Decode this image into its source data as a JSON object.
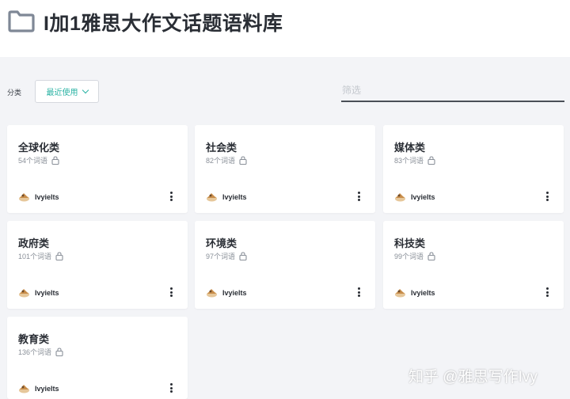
{
  "header": {
    "title": "I加1雅思大作文话题语料库"
  },
  "filter": {
    "category_label": "分类",
    "sort_value": "最近使用",
    "search_placeholder": "筛选"
  },
  "cards": [
    {
      "title": "全球化类",
      "count": "54个词语",
      "author": "Ivyielts"
    },
    {
      "title": "社会类",
      "count": "82个词语",
      "author": "Ivyielts"
    },
    {
      "title": "媒体类",
      "count": "83个词语",
      "author": "Ivyielts"
    },
    {
      "title": "政府类",
      "count": "101个词语",
      "author": "Ivyielts"
    },
    {
      "title": "环境类",
      "count": "97个词语",
      "author": "Ivyielts"
    },
    {
      "title": "科技类",
      "count": "99个词语",
      "author": "Ivyielts"
    },
    {
      "title": "教育类",
      "count": "136个词语",
      "author": "Ivyielts"
    }
  ],
  "watermark": "知乎 @雅思写作Ivy",
  "colors": {
    "accent": "#2bb3a4",
    "background": "#f3f4f7",
    "card": "#ffffff"
  },
  "icons": {
    "header": "folder-icon",
    "card_meta": "lock-icon",
    "card_menu": "more-vertical-icon",
    "author": "avatar"
  }
}
